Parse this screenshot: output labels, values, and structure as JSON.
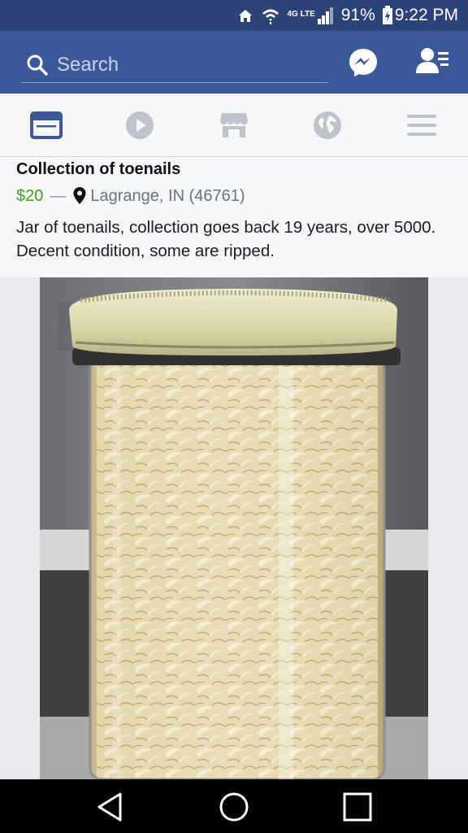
{
  "status_bar": {
    "network": "4G LTE",
    "battery": "91%",
    "time": "9:22 PM"
  },
  "header": {
    "search_placeholder": "Search",
    "icons": [
      "search-icon",
      "messenger-icon",
      "friend-requests-icon"
    ]
  },
  "tabs": [
    {
      "name": "news-feed",
      "icon": "news-feed-icon",
      "active": true
    },
    {
      "name": "video",
      "icon": "play-icon",
      "active": false
    },
    {
      "name": "marketplace",
      "icon": "shop-icon",
      "active": false
    },
    {
      "name": "notifications",
      "icon": "globe-icon",
      "active": false
    },
    {
      "name": "menu",
      "icon": "menu-icon",
      "active": false
    }
  ],
  "post": {
    "title": "Collection of toenails",
    "price": "$20",
    "separator": "—",
    "location": "Lagrange, IN (46761)",
    "description": "Jar of toenails, collection goes back 19 years, over 5000. Decent condition, some are ripped."
  },
  "nav": {
    "icons": [
      "back-icon",
      "home-icon",
      "recents-icon"
    ]
  },
  "colors": {
    "status_bar": "#2c4379",
    "header": "#3b5998",
    "active_tab": "#3b5998",
    "inactive_tab": "#bec3c9",
    "price": "#42a01a"
  }
}
